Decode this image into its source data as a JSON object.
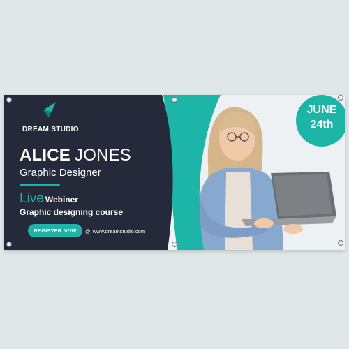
{
  "brand": {
    "name": "DREAM STUDIO",
    "logo_icon": "triangle-logo-icon"
  },
  "speaker": {
    "first_name": "ALICE",
    "last_name": "JONES",
    "role": "Graphic Designer"
  },
  "event": {
    "live_label": "Live",
    "format": "Webiner",
    "course": "Graphic designing course",
    "register_label": "REGISTER NOW",
    "website_prefix": "@",
    "website": "www.dreamstudio.com"
  },
  "date": {
    "month": "JUNE",
    "day": "24th"
  },
  "colors": {
    "dark_panel": "#242a3a",
    "accent": "#1cb5a8",
    "background": "#dfe7e8"
  }
}
